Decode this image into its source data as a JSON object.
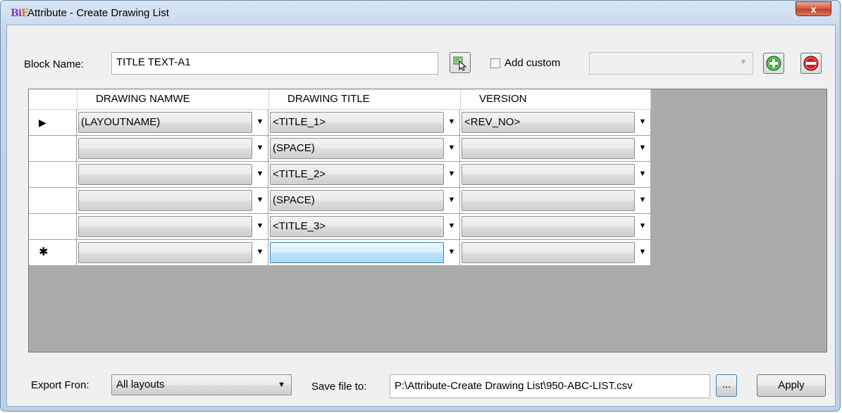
{
  "window": {
    "title": "Attribute - Create Drawing List",
    "icon_text": "BiE",
    "close_glyph": "x"
  },
  "block": {
    "label": "Block Name:",
    "value": "TITLE TEXT-A1"
  },
  "add_custom": {
    "label": "Add custom",
    "checked": false,
    "combo_value": ""
  },
  "grid": {
    "columns": [
      "DRAWING NAMWE",
      "DRAWING TITLE",
      "VERSION"
    ],
    "rows": [
      {
        "marker": "▶",
        "cells": [
          "(LAYOUTNAME)",
          "<TITLE_1>",
          "<REV_NO>"
        ]
      },
      {
        "marker": "",
        "cells": [
          "",
          "(SPACE)",
          ""
        ]
      },
      {
        "marker": "",
        "cells": [
          "",
          "<TITLE_2>",
          ""
        ]
      },
      {
        "marker": "",
        "cells": [
          "",
          "(SPACE)",
          ""
        ]
      },
      {
        "marker": "",
        "cells": [
          "",
          "<TITLE_3>",
          ""
        ]
      },
      {
        "marker": "✱",
        "cells": [
          "",
          "",
          ""
        ]
      }
    ]
  },
  "export": {
    "label": "Export Fron:",
    "value": "All layouts"
  },
  "save": {
    "label": "Save file to:",
    "value": "P:\\Attribute-Create Drawing List\\950-ABC-LIST.csv",
    "browse_label": "...",
    "apply_label": "Apply"
  },
  "icons": {
    "pick": "select-block-icon",
    "add": "add-icon",
    "remove": "remove-icon"
  },
  "colors": {
    "add_green": "#3aa335",
    "remove_red": "#d42020",
    "grid_background": "#ababab"
  }
}
